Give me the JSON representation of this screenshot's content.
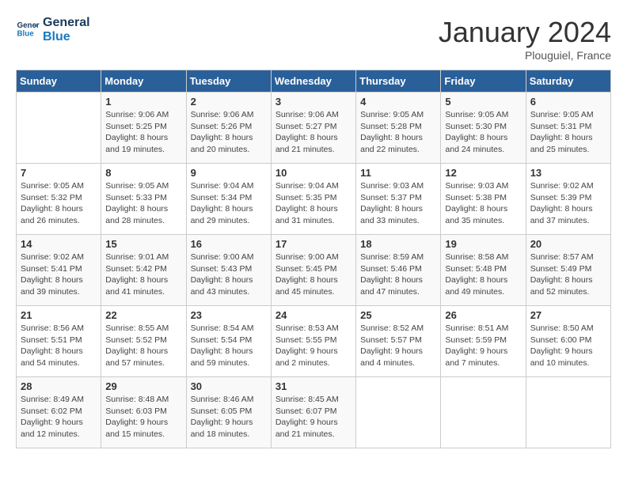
{
  "logo": {
    "line1": "General",
    "line2": "Blue"
  },
  "title": "January 2024",
  "location": "Plouguiel, France",
  "days_of_week": [
    "Sunday",
    "Monday",
    "Tuesday",
    "Wednesday",
    "Thursday",
    "Friday",
    "Saturday"
  ],
  "weeks": [
    [
      {
        "day": "",
        "sunrise": "",
        "sunset": "",
        "daylight": ""
      },
      {
        "day": "1",
        "sunrise": "Sunrise: 9:06 AM",
        "sunset": "Sunset: 5:25 PM",
        "daylight": "Daylight: 8 hours and 19 minutes."
      },
      {
        "day": "2",
        "sunrise": "Sunrise: 9:06 AM",
        "sunset": "Sunset: 5:26 PM",
        "daylight": "Daylight: 8 hours and 20 minutes."
      },
      {
        "day": "3",
        "sunrise": "Sunrise: 9:06 AM",
        "sunset": "Sunset: 5:27 PM",
        "daylight": "Daylight: 8 hours and 21 minutes."
      },
      {
        "day": "4",
        "sunrise": "Sunrise: 9:05 AM",
        "sunset": "Sunset: 5:28 PM",
        "daylight": "Daylight: 8 hours and 22 minutes."
      },
      {
        "day": "5",
        "sunrise": "Sunrise: 9:05 AM",
        "sunset": "Sunset: 5:30 PM",
        "daylight": "Daylight: 8 hours and 24 minutes."
      },
      {
        "day": "6",
        "sunrise": "Sunrise: 9:05 AM",
        "sunset": "Sunset: 5:31 PM",
        "daylight": "Daylight: 8 hours and 25 minutes."
      }
    ],
    [
      {
        "day": "7",
        "sunrise": "Sunrise: 9:05 AM",
        "sunset": "Sunset: 5:32 PM",
        "daylight": "Daylight: 8 hours and 26 minutes."
      },
      {
        "day": "8",
        "sunrise": "Sunrise: 9:05 AM",
        "sunset": "Sunset: 5:33 PM",
        "daylight": "Daylight: 8 hours and 28 minutes."
      },
      {
        "day": "9",
        "sunrise": "Sunrise: 9:04 AM",
        "sunset": "Sunset: 5:34 PM",
        "daylight": "Daylight: 8 hours and 29 minutes."
      },
      {
        "day": "10",
        "sunrise": "Sunrise: 9:04 AM",
        "sunset": "Sunset: 5:35 PM",
        "daylight": "Daylight: 8 hours and 31 minutes."
      },
      {
        "day": "11",
        "sunrise": "Sunrise: 9:03 AM",
        "sunset": "Sunset: 5:37 PM",
        "daylight": "Daylight: 8 hours and 33 minutes."
      },
      {
        "day": "12",
        "sunrise": "Sunrise: 9:03 AM",
        "sunset": "Sunset: 5:38 PM",
        "daylight": "Daylight: 8 hours and 35 minutes."
      },
      {
        "day": "13",
        "sunrise": "Sunrise: 9:02 AM",
        "sunset": "Sunset: 5:39 PM",
        "daylight": "Daylight: 8 hours and 37 minutes."
      }
    ],
    [
      {
        "day": "14",
        "sunrise": "Sunrise: 9:02 AM",
        "sunset": "Sunset: 5:41 PM",
        "daylight": "Daylight: 8 hours and 39 minutes."
      },
      {
        "day": "15",
        "sunrise": "Sunrise: 9:01 AM",
        "sunset": "Sunset: 5:42 PM",
        "daylight": "Daylight: 8 hours and 41 minutes."
      },
      {
        "day": "16",
        "sunrise": "Sunrise: 9:00 AM",
        "sunset": "Sunset: 5:43 PM",
        "daylight": "Daylight: 8 hours and 43 minutes."
      },
      {
        "day": "17",
        "sunrise": "Sunrise: 9:00 AM",
        "sunset": "Sunset: 5:45 PM",
        "daylight": "Daylight: 8 hours and 45 minutes."
      },
      {
        "day": "18",
        "sunrise": "Sunrise: 8:59 AM",
        "sunset": "Sunset: 5:46 PM",
        "daylight": "Daylight: 8 hours and 47 minutes."
      },
      {
        "day": "19",
        "sunrise": "Sunrise: 8:58 AM",
        "sunset": "Sunset: 5:48 PM",
        "daylight": "Daylight: 8 hours and 49 minutes."
      },
      {
        "day": "20",
        "sunrise": "Sunrise: 8:57 AM",
        "sunset": "Sunset: 5:49 PM",
        "daylight": "Daylight: 8 hours and 52 minutes."
      }
    ],
    [
      {
        "day": "21",
        "sunrise": "Sunrise: 8:56 AM",
        "sunset": "Sunset: 5:51 PM",
        "daylight": "Daylight: 8 hours and 54 minutes."
      },
      {
        "day": "22",
        "sunrise": "Sunrise: 8:55 AM",
        "sunset": "Sunset: 5:52 PM",
        "daylight": "Daylight: 8 hours and 57 minutes."
      },
      {
        "day": "23",
        "sunrise": "Sunrise: 8:54 AM",
        "sunset": "Sunset: 5:54 PM",
        "daylight": "Daylight: 8 hours and 59 minutes."
      },
      {
        "day": "24",
        "sunrise": "Sunrise: 8:53 AM",
        "sunset": "Sunset: 5:55 PM",
        "daylight": "Daylight: 9 hours and 2 minutes."
      },
      {
        "day": "25",
        "sunrise": "Sunrise: 8:52 AM",
        "sunset": "Sunset: 5:57 PM",
        "daylight": "Daylight: 9 hours and 4 minutes."
      },
      {
        "day": "26",
        "sunrise": "Sunrise: 8:51 AM",
        "sunset": "Sunset: 5:59 PM",
        "daylight": "Daylight: 9 hours and 7 minutes."
      },
      {
        "day": "27",
        "sunrise": "Sunrise: 8:50 AM",
        "sunset": "Sunset: 6:00 PM",
        "daylight": "Daylight: 9 hours and 10 minutes."
      }
    ],
    [
      {
        "day": "28",
        "sunrise": "Sunrise: 8:49 AM",
        "sunset": "Sunset: 6:02 PM",
        "daylight": "Daylight: 9 hours and 12 minutes."
      },
      {
        "day": "29",
        "sunrise": "Sunrise: 8:48 AM",
        "sunset": "Sunset: 6:03 PM",
        "daylight": "Daylight: 9 hours and 15 minutes."
      },
      {
        "day": "30",
        "sunrise": "Sunrise: 8:46 AM",
        "sunset": "Sunset: 6:05 PM",
        "daylight": "Daylight: 9 hours and 18 minutes."
      },
      {
        "day": "31",
        "sunrise": "Sunrise: 8:45 AM",
        "sunset": "Sunset: 6:07 PM",
        "daylight": "Daylight: 9 hours and 21 minutes."
      },
      {
        "day": "",
        "sunrise": "",
        "sunset": "",
        "daylight": ""
      },
      {
        "day": "",
        "sunrise": "",
        "sunset": "",
        "daylight": ""
      },
      {
        "day": "",
        "sunrise": "",
        "sunset": "",
        "daylight": ""
      }
    ]
  ]
}
